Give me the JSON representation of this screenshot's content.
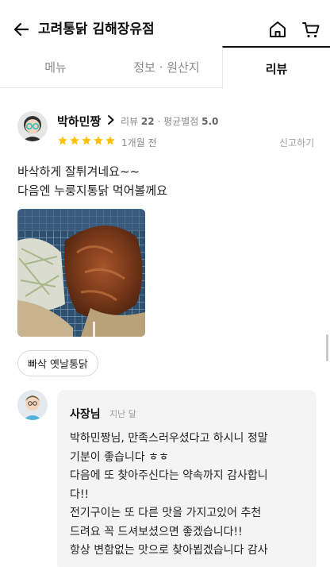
{
  "header": {
    "title": "고려통닭 김해장유점",
    "back_icon": "back-arrow-icon",
    "home_icon": "home-icon",
    "cart_icon": "cart-icon"
  },
  "tabs": [
    {
      "label": "메뉴",
      "active": false
    },
    {
      "label": "정보 · 원산지",
      "active": false
    },
    {
      "label": "리뷰",
      "active": true
    }
  ],
  "review": {
    "reviewer_name": "박하민짱",
    "review_count_label": "리뷰",
    "review_count": "22",
    "separator": "·",
    "avg_label": "평균별점",
    "avg_rating": "5.0",
    "rating": 5,
    "date": "1개월 전",
    "report_label": "신고하기",
    "text_lines": [
      "바삭하게 잘튀겨네요~~",
      "다음엔 누룽지통닭 먹어볼께요"
    ],
    "menu_tag": "빠삭 옛날통닭",
    "star_color": "#ffc107"
  },
  "owner_reply": {
    "name": "사장님",
    "date": "지난 달",
    "lines": [
      "박하민짱님, 만족스러우셨다고 하시니 정말",
      "기분이 좋습니다 ㅎㅎ",
      "다음에 또 찾아주신다는 약속까지 감사합니",
      "다!!",
      "전기구이는 또 다른 맛을 가지고있어 추천",
      "드려요 꼭 드셔보셨으면 좋겠습니다!!",
      "항상 변함없는 맛으로 찾아뵙겠습니다 감사"
    ]
  }
}
